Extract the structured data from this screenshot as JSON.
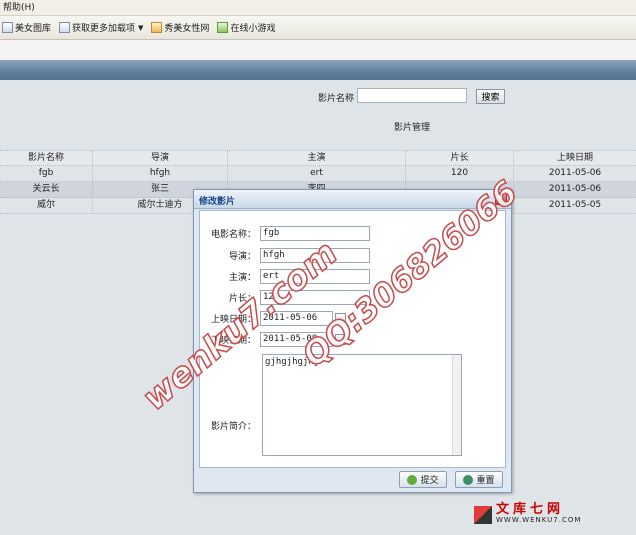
{
  "browser": {
    "menu": "帮助(H)",
    "favorites": [
      {
        "label": "美女图库",
        "icon": "page-icon"
      },
      {
        "label": "获取更多加载项",
        "icon": "page-icon",
        "dropdown": true
      },
      {
        "label": "秀美女性网",
        "icon": "star-icon"
      },
      {
        "label": "在线小游戏",
        "icon": "game-icon"
      }
    ]
  },
  "search": {
    "label": "影片名称",
    "value": "",
    "button": "搜索"
  },
  "section_title": "影片管理",
  "table": {
    "columns": [
      "影片名称",
      "导演",
      "主演",
      "片长",
      "上映日期"
    ],
    "rows": [
      [
        "fgb",
        "hfgh",
        "ert",
        "120",
        "2011-05-06"
      ],
      [
        "关云长",
        "张三",
        "李四",
        "",
        "2011-05-06"
      ],
      [
        "威尔",
        "威尔士迪方",
        "",
        "",
        "2011-05-05"
      ]
    ]
  },
  "dialog": {
    "title": "修改影片",
    "fields": {
      "name_label": "电影名称：",
      "name_value": "fgb",
      "director_label": "导演：",
      "director_value": "hfgh",
      "actor_label": "主演：",
      "actor_value": "ert",
      "length_label": "片长：",
      "length_value": "120",
      "release_label": "上映日期：",
      "release_value": "2011-05-06",
      "offline_label": "下映日期：",
      "offline_value": "2011-05-08",
      "desc_label": "影片简介：",
      "desc_value": "gjhgjhgjhj"
    },
    "submit": "提交",
    "reset": "重置"
  },
  "watermarks": [
    "wenku7.com",
    "QQ:306826066"
  ],
  "logo": {
    "cn": "文库七网",
    "url": "WWW.WENKU7.COM"
  },
  "colors": {
    "banner": "#5f7e9c",
    "dialog_title": "#15428b",
    "watermark": "#c84a4a",
    "logo_red": "#cc0000"
  }
}
